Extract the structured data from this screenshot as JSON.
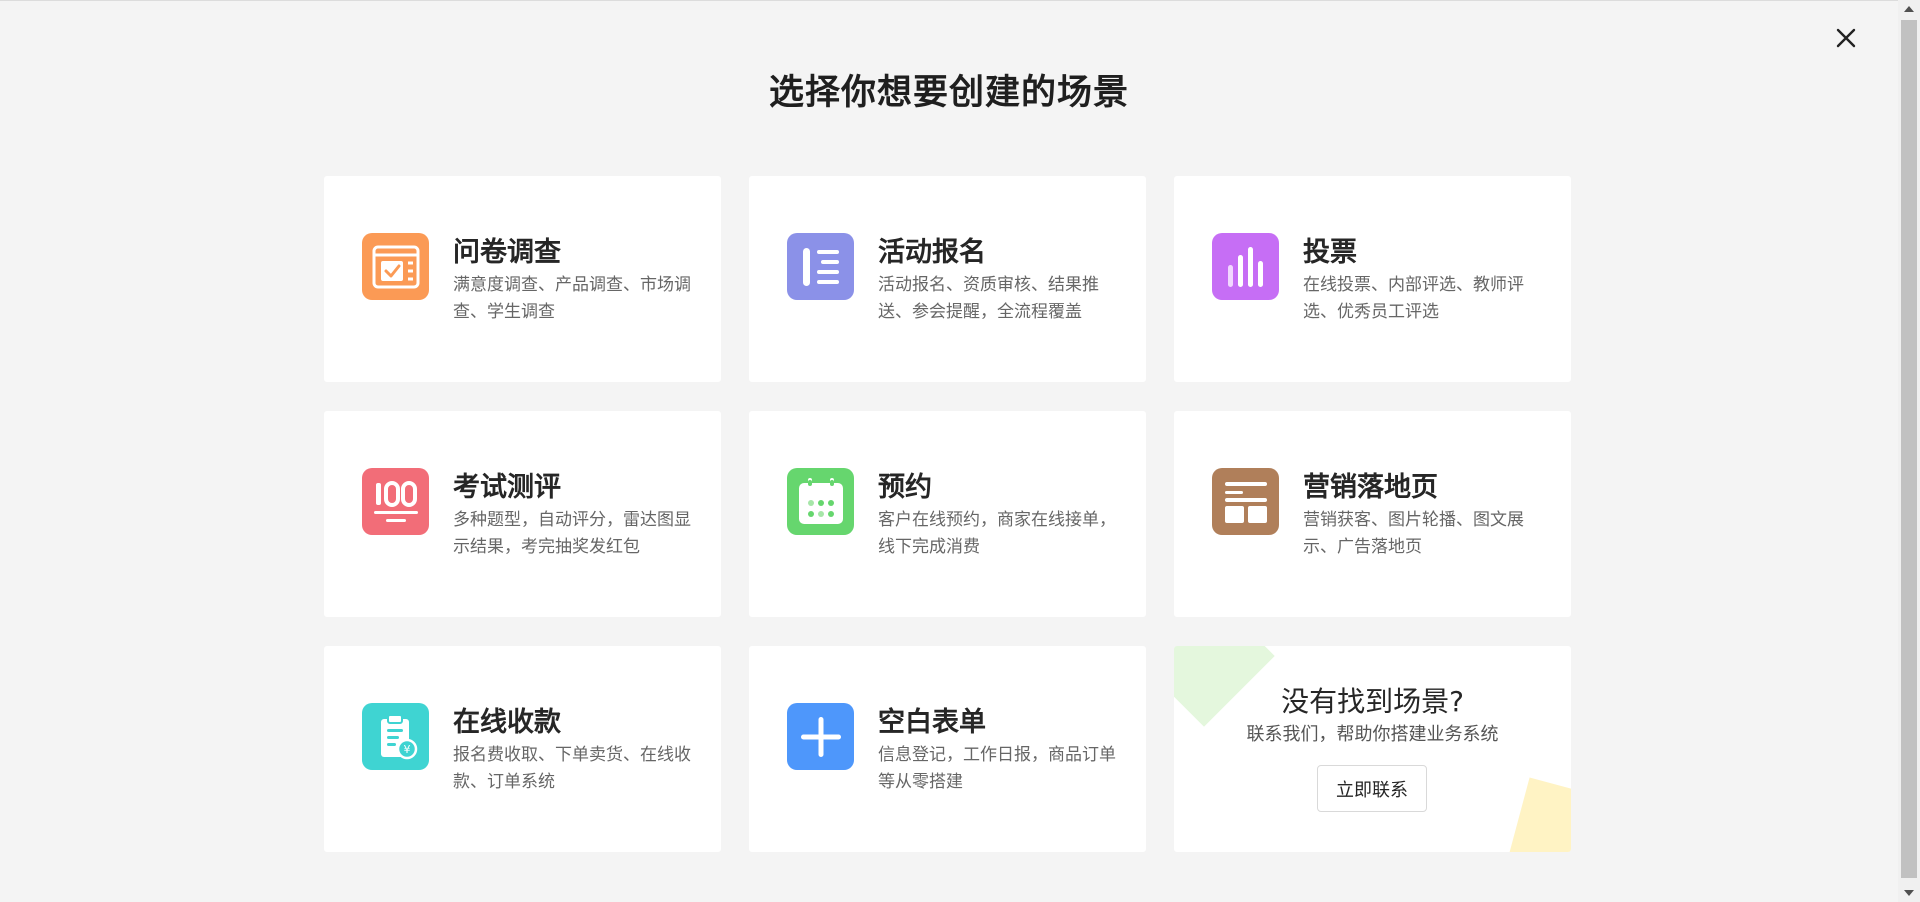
{
  "page": {
    "title": "选择你想要创建的场景",
    "close_icon": "close-icon"
  },
  "colors": {
    "background": "#f4f4f4",
    "card": "#ffffff",
    "survey": "#fb9a55",
    "event": "#8b91e8",
    "vote": "#c66ef5",
    "exam": "#f26d78",
    "booking": "#66d66e",
    "marketing": "#b07f5a",
    "payment": "#3fd4d2",
    "blank": "#4e97fb"
  },
  "cards": [
    {
      "title": "问卷调查",
      "desc": "满意度调查、产品调查、市场调查、学生调查",
      "icon": "survey-checkbox-icon"
    },
    {
      "title": "活动报名",
      "desc": "活动报名、资质审核、结果推送、参会提醒，全流程覆盖",
      "icon": "event-list-icon"
    },
    {
      "title": "投票",
      "desc": "在线投票、内部评选、教师评选、优秀员工评选",
      "icon": "vote-bars-icon"
    },
    {
      "title": "考试测评",
      "desc": "多种题型，自动评分，雷达图显示结果，考完抽奖发红包",
      "icon": "exam-score-icon"
    },
    {
      "title": "预约",
      "desc": "客户在线预约，商家在线接单，线下完成消费",
      "icon": "calendar-icon"
    },
    {
      "title": "营销落地页",
      "desc": "营销获客、图片轮播、图文展示、广告落地页",
      "icon": "landing-page-icon"
    },
    {
      "title": "在线收款",
      "desc": "报名费收取、下单卖货、在线收款、订单系统",
      "icon": "payment-clipboard-icon"
    },
    {
      "title": "空白表单",
      "desc": "信息登记，工作日报，商品订单等从零搭建",
      "icon": "plus-icon"
    }
  ],
  "contact": {
    "title": "没有找到场景?",
    "subtitle": "联系我们，帮助你搭建业务系统",
    "button": "立即联系"
  }
}
